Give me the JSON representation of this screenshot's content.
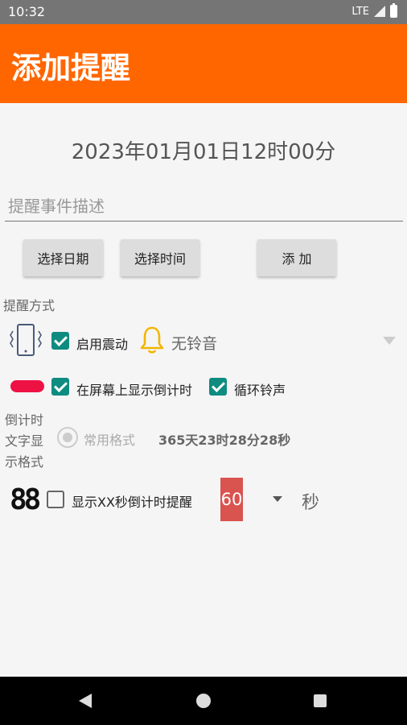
{
  "status": {
    "time": "10:32",
    "network": "LTE"
  },
  "app": {
    "title": "添加提醒"
  },
  "datetime": "2023年01月01日12时00分",
  "event_input": {
    "placeholder": "提醒事件描述",
    "value": ""
  },
  "buttons": {
    "select_date": "选择日期",
    "select_time": "选择时间",
    "add": "添 加"
  },
  "reminder_method": {
    "heading": "提醒方式",
    "vibrate_label": "启用震动",
    "vibrate_checked": true,
    "ringtone_label": "无铃音",
    "countdown_screen_label": "在屏幕上显示倒计时",
    "countdown_screen_checked": true,
    "loop_ring_label": "循环铃声",
    "loop_ring_checked": true
  },
  "countdown_format": {
    "label_line1": "倒计时",
    "label_line2": "文字显",
    "label_line3": "示格式",
    "option_label": "常用格式",
    "example": "365天23时28分28秒"
  },
  "xx_reminder": {
    "label": "显示XX秒倒计时提醒",
    "checked": false,
    "seconds_value": "60",
    "unit": "秒"
  },
  "colors": {
    "accent": "#ff6600",
    "checkbox": "#0e8c80",
    "seconds_box": "#d9534f",
    "bell": "#f2b600",
    "pill": "#ee1144"
  }
}
